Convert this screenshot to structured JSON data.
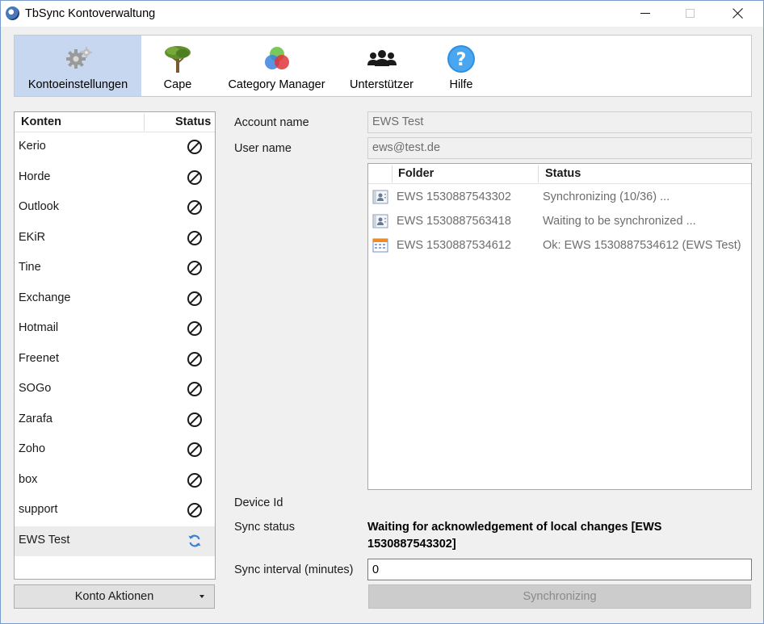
{
  "window": {
    "title": "TbSync Kontoverwaltung"
  },
  "toolbar": {
    "items": [
      {
        "label": "Kontoeinstellungen",
        "icon": "gear-icon",
        "active": true
      },
      {
        "label": "Cape",
        "icon": "tree-icon",
        "active": false
      },
      {
        "label": "Category Manager",
        "icon": "color-circles-icon",
        "active": false
      },
      {
        "label": "Unterstützer",
        "icon": "people-icon",
        "active": false
      },
      {
        "label": "Hilfe",
        "icon": "help-icon",
        "active": false
      }
    ]
  },
  "accounts": {
    "header_name": "Konten",
    "header_status": "Status",
    "items": [
      {
        "name": "Kerio",
        "status": "disabled"
      },
      {
        "name": "Horde",
        "status": "disabled"
      },
      {
        "name": "Outlook",
        "status": "disabled"
      },
      {
        "name": "EKiR",
        "status": "disabled"
      },
      {
        "name": "Tine",
        "status": "disabled"
      },
      {
        "name": "Exchange",
        "status": "disabled"
      },
      {
        "name": "Hotmail",
        "status": "disabled"
      },
      {
        "name": "Freenet",
        "status": "disabled"
      },
      {
        "name": "SOGo",
        "status": "disabled"
      },
      {
        "name": "Zarafa",
        "status": "disabled"
      },
      {
        "name": "Zoho",
        "status": "disabled"
      },
      {
        "name": "box",
        "status": "disabled"
      },
      {
        "name": "support",
        "status": "disabled"
      },
      {
        "name": "EWS Test",
        "status": "syncing",
        "selected": true
      }
    ],
    "action_button": "Konto Aktionen"
  },
  "details": {
    "account_name_label": "Account name",
    "account_name_value": "EWS Test",
    "user_name_label": "User name",
    "user_name_value": "ews@test.de",
    "folders": {
      "header_folder": "Folder",
      "header_status": "Status",
      "rows": [
        {
          "icon": "contacts-icon",
          "name": "EWS 1530887543302",
          "status": "Synchronizing (10/36) ..."
        },
        {
          "icon": "contacts-icon",
          "name": "EWS 1530887563418",
          "status": "Waiting to be synchronized ..."
        },
        {
          "icon": "calendar-icon",
          "name": "EWS 1530887534612",
          "status": "Ok: EWS 1530887534612 (EWS Test)"
        }
      ]
    },
    "device_id_label": "Device Id",
    "sync_status_label": "Sync status",
    "sync_status_value": "Waiting for acknowledgement of local changes [EWS 1530887543302]",
    "sync_interval_label": "Sync interval (minutes)",
    "sync_interval_value": "0",
    "sync_button": "Synchronizing"
  },
  "colors": {
    "toolbar_active_bg": "#c6d7ef",
    "selected_row_bg": "#ececec",
    "sync_icon": "#3a7fd8",
    "disabled_icon": "#1a1a1a"
  }
}
